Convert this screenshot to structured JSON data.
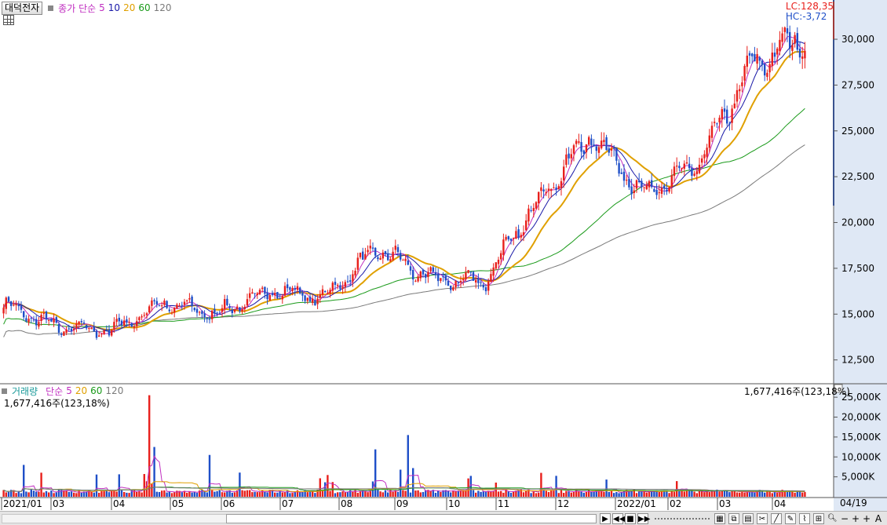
{
  "header": {
    "symbol": "대덕전자",
    "indicator": "종가 단순",
    "ma_periods": [
      "5",
      "10",
      "20",
      "60",
      "120"
    ],
    "lc": "LC:128,35",
    "hc": "HC:-3,72"
  },
  "colors": {
    "up": "#e8201c",
    "down": "#1f4fc8",
    "ma5": "#c02ec0",
    "ma10": "#1a1aa8",
    "ma20": "#e0a000",
    "ma60": "#1a9a1a",
    "ma120": "#7a7a7a"
  },
  "volume_panel": {
    "title": "거래량",
    "indicator": "단순",
    "ma_periods": [
      "5",
      "20",
      "60",
      "120"
    ],
    "current_left": "1,677,416주(123,18%)",
    "current_right": "1,677,416주(123,18%)"
  },
  "bottom_label": "04/19",
  "chart_data": {
    "type": "candlestick",
    "x_axis_labels": [
      "2021/01",
      "03",
      "04",
      "05",
      "06",
      "07",
      "08",
      "09",
      "10",
      "11",
      "12",
      "2022/01",
      "02",
      "03",
      "04"
    ],
    "price_axis": {
      "ticks": [
        "30,000",
        "27,500",
        "25,000",
        "22,500",
        "20,000",
        "17,500",
        "15,000",
        "12,500"
      ],
      "ylim": [
        11500,
        31800
      ]
    },
    "volume_axis": {
      "ticks": [
        "25,000K",
        "20,000K",
        "15,000K",
        "10,000K",
        "5,000K"
      ],
      "ylim": [
        0,
        27000
      ]
    },
    "monthly_close": [
      {
        "month": "2021/01",
        "close": 15500
      },
      {
        "month": "2021/02",
        "close": 14300
      },
      {
        "month": "2021/03",
        "close": 14100
      },
      {
        "month": "2021/04",
        "close": 15600
      },
      {
        "month": "2021/05",
        "close": 15000
      },
      {
        "month": "2021/06",
        "close": 16300
      },
      {
        "month": "2021/07",
        "close": 15900
      },
      {
        "month": "2021/08",
        "close": 18600
      },
      {
        "month": "2021/09",
        "close": 16900
      },
      {
        "month": "2021/10",
        "close": 16800
      },
      {
        "month": "2021/11",
        "close": 21200
      },
      {
        "month": "2021/12",
        "close": 24800
      },
      {
        "month": "2022/01",
        "close": 21500
      },
      {
        "month": "2022/02",
        "close": 23200
      },
      {
        "month": "2022/03",
        "close": 28600
      },
      {
        "month": "2022/04",
        "close": 30200
      }
    ],
    "series": [
      {
        "name": "5"
      },
      {
        "name": "10"
      },
      {
        "name": "20"
      },
      {
        "name": "60"
      },
      {
        "name": "120"
      }
    ]
  }
}
